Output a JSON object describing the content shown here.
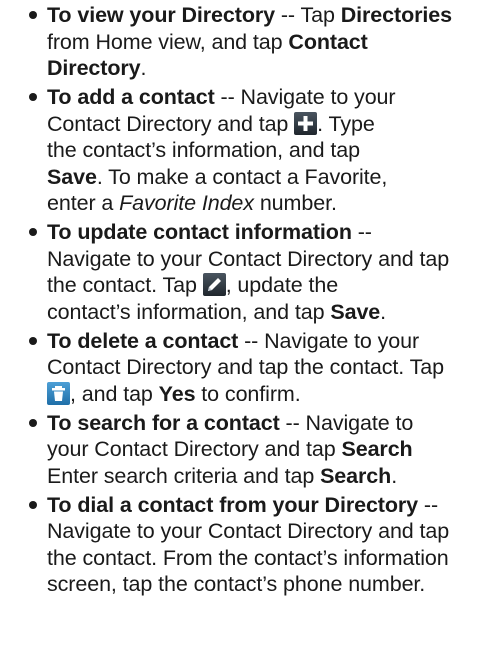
{
  "items": [
    {
      "title": "To view your Directory",
      "sep": " -- ",
      "l1a": "Tap ",
      "l1b": "Directories",
      "l2a": "from Home view, and tap ",
      "l2b": "Contact",
      "l3a": "Directory",
      "l3b": "."
    },
    {
      "title": "To add a contact",
      "sep": " -- ",
      "l1a": "Navigate to your",
      "l2a": "Contact Directory and tap ",
      "l2icon": "plus-icon",
      "l2b": ". Type",
      "l3a": "the contact’s information, and tap",
      "l4a": "Save",
      "l4b": ". To make a contact a Favorite,",
      "l5a": "enter a ",
      "l5b": "Favorite Index",
      "l5c": " number."
    },
    {
      "title": "To update contact information",
      "sep": " --",
      "l2a": "Navigate to your Contact Directory and tap",
      "l3a": "the contact. Tap ",
      "l3icon": "pencil-icon",
      "l3b": ", update the",
      "l4a": "contact’s information, and tap ",
      "l4b": "Save",
      "l4c": "."
    },
    {
      "title": "To delete a contact",
      "sep": " -- ",
      "l1a": "Navigate to your",
      "l2a": "Contact Directory and tap the contact. Tap",
      "l3icon": "trash-icon",
      "l3a": ", and tap ",
      "l3b": "Yes",
      "l3c": " to confirm."
    },
    {
      "title": "To search for a contact",
      "sep": " -- ",
      "l1a": "Navigate to",
      "l2a": "your Contact Directory and tap ",
      "l2b": "Search",
      "l3a": "Enter search criteria and tap ",
      "l3b": "Search",
      "l3c": "."
    },
    {
      "title": "To dial a contact from your Directory",
      "sep": " --",
      "l2a": "Navigate to your Contact Directory and tap",
      "l3a": "the contact. From the contact’s information",
      "l4a": "screen, tap the contact’s phone number."
    }
  ]
}
